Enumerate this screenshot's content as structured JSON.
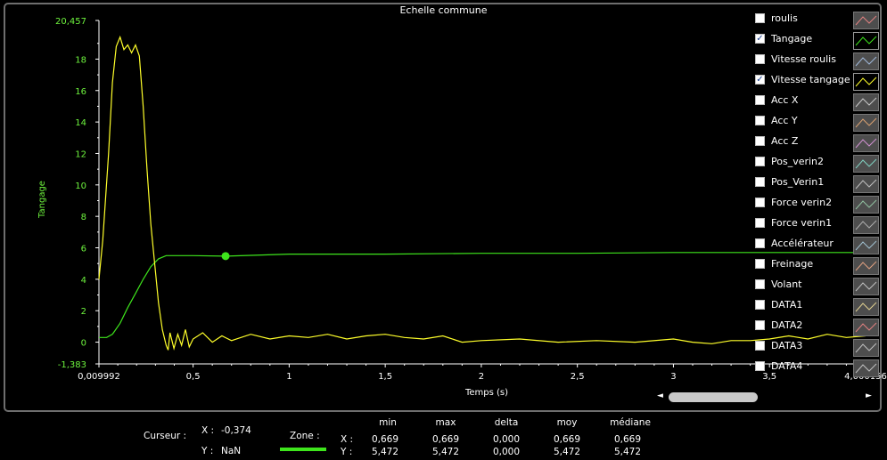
{
  "window": {
    "title": "Echelle commune"
  },
  "chart_data": {
    "type": "line",
    "xlabel": "Temps (s)",
    "ylabel": "Tangage",
    "xlim": [
      0.009992,
      4.000156
    ],
    "ylim": [
      -1.383,
      20.457
    ],
    "x_ticks": [
      "0,009992",
      "0,5",
      "1",
      "1,5",
      "2",
      "2,5",
      "3",
      "3,5",
      "4,000156"
    ],
    "x_tick_values": [
      0.009992,
      0.5,
      1,
      1.5,
      2,
      2.5,
      3,
      3.5,
      4.000156
    ],
    "y_ticks": [
      "20,457",
      "18",
      "16",
      "14",
      "12",
      "10",
      "8",
      "6",
      "4",
      "2",
      "0",
      "-1,383"
    ],
    "y_tick_values": [
      20.457,
      18,
      16,
      14,
      12,
      10,
      8,
      6,
      4,
      2,
      0,
      -1.383
    ],
    "series": [
      {
        "name": "Tangage",
        "color": "#3ee51c",
        "x": [
          0.01,
          0.05,
          0.08,
          0.12,
          0.16,
          0.2,
          0.24,
          0.28,
          0.32,
          0.36,
          0.4,
          0.5,
          0.669,
          1.0,
          1.5,
          2.0,
          2.5,
          3.0,
          3.5,
          4.0
        ],
        "y": [
          0.3,
          0.3,
          0.5,
          1.2,
          2.2,
          3.1,
          4.0,
          4.8,
          5.3,
          5.5,
          5.5,
          5.5,
          5.47,
          5.6,
          5.6,
          5.65,
          5.65,
          5.7,
          5.7,
          5.7
        ]
      },
      {
        "name": "Vitesse tangage",
        "color": "#ffff2a",
        "x": [
          0.01,
          0.03,
          0.06,
          0.08,
          0.1,
          0.12,
          0.14,
          0.16,
          0.18,
          0.2,
          0.22,
          0.24,
          0.26,
          0.28,
          0.3,
          0.32,
          0.34,
          0.36,
          0.37,
          0.38,
          0.4,
          0.42,
          0.44,
          0.46,
          0.48,
          0.5,
          0.55,
          0.6,
          0.65,
          0.7,
          0.8,
          0.9,
          1.0,
          1.1,
          1.2,
          1.3,
          1.4,
          1.5,
          1.6,
          1.7,
          1.8,
          1.9,
          2.0,
          2.2,
          2.4,
          2.6,
          2.8,
          3.0,
          3.1,
          3.2,
          3.3,
          3.4,
          3.5,
          3.6,
          3.7,
          3.8,
          3.9,
          4.0
        ],
        "y": [
          4.0,
          6.5,
          12.0,
          16.5,
          18.8,
          19.4,
          18.6,
          18.9,
          18.4,
          18.9,
          18.2,
          15.0,
          11.0,
          7.5,
          5.0,
          2.5,
          0.8,
          -0.2,
          -0.5,
          0.6,
          -0.4,
          0.5,
          -0.2,
          0.8,
          -0.3,
          0.2,
          0.6,
          0.0,
          0.4,
          0.1,
          0.5,
          0.2,
          0.4,
          0.3,
          0.5,
          0.2,
          0.4,
          0.5,
          0.3,
          0.2,
          0.4,
          0.0,
          0.1,
          0.2,
          0.0,
          0.1,
          0.0,
          0.2,
          0.0,
          -0.1,
          0.1,
          0.1,
          0.2,
          0.4,
          0.2,
          0.5,
          0.3,
          0.4
        ]
      }
    ],
    "cursor_point": {
      "x": 0.669,
      "y": 5.472,
      "color": "#3ee51c"
    },
    "grid": true
  },
  "legend": {
    "items": [
      {
        "label": "roulis",
        "checked": false,
        "color": "#e08080",
        "active": false
      },
      {
        "label": "Tangage",
        "checked": true,
        "color": "#3ee51c",
        "active": true
      },
      {
        "label": "Vitesse roulis",
        "checked": false,
        "color": "#9fb7d8",
        "active": false
      },
      {
        "label": "Vitesse tangage",
        "checked": true,
        "color": "#ffff2a",
        "active": true
      },
      {
        "label": "Acc X",
        "checked": false,
        "color": "#c8c8c8",
        "active": false
      },
      {
        "label": "Acc Y",
        "checked": false,
        "color": "#d8a070",
        "active": false
      },
      {
        "label": "Acc Z",
        "checked": false,
        "color": "#d090d0",
        "active": false
      },
      {
        "label": "Pos_verin2",
        "checked": false,
        "color": "#80d0c0",
        "active": false
      },
      {
        "label": "Pos_Verin1",
        "checked": false,
        "color": "#c0c0c0",
        "active": false
      },
      {
        "label": "Force verin2",
        "checked": false,
        "color": "#90c0a0",
        "active": false
      },
      {
        "label": "Force verin1",
        "checked": false,
        "color": "#b0b0b0",
        "active": false
      },
      {
        "label": "Accélérateur",
        "checked": false,
        "color": "#a0c0d0",
        "active": false
      },
      {
        "label": "Freinage",
        "checked": false,
        "color": "#e0a080",
        "active": false
      },
      {
        "label": "Volant",
        "checked": false,
        "color": "#c0c0c0",
        "active": false
      },
      {
        "label": "DATA1",
        "checked": false,
        "color": "#e0d090",
        "active": false
      },
      {
        "label": "DATA2",
        "checked": false,
        "color": "#e08080",
        "active": false
      },
      {
        "label": "DATA3",
        "checked": false,
        "color": "#c0c0c0",
        "active": false
      },
      {
        "label": "DATA4",
        "checked": false,
        "color": "#c0c0c0",
        "active": false
      }
    ]
  },
  "scrollbar": {
    "left_arrow": "◄",
    "right_arrow": "►"
  },
  "cursor": {
    "label": "Curseur :",
    "x_label": "X :",
    "x_value": "-0,374",
    "y_label": "Y :",
    "y_value": "NaN"
  },
  "zone": {
    "label": "Zone :",
    "x_label": "X :",
    "y_label": "Y :",
    "color": "#3ee51c",
    "columns": [
      "min",
      "max",
      "delta",
      "moy",
      "médiane"
    ],
    "x_values": [
      "0,669",
      "0,669",
      "0,000",
      "0,669",
      "0,669"
    ],
    "y_values": [
      "5,472",
      "5,472",
      "0,000",
      "5,472",
      "5,472"
    ]
  }
}
